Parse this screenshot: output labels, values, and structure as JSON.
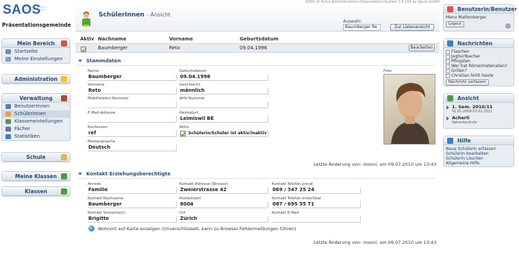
{
  "header": {
    "logo": "SAOS",
    "logo_tagline": "Schul-Administrations-Organisations-System",
    "school": "Präsentationsgemeinde",
    "version_line": "SAOS.ch Schul-Administrations-Organisations-System 0.5.100 by dgure GmbH"
  },
  "left_nav": {
    "mein_bereich": {
      "title": "Mein Bereich",
      "items": [
        "Startseite",
        "Meine Einstellungen"
      ]
    },
    "administration": {
      "title": "Administration"
    },
    "verwaltung": {
      "title": "Verwaltung",
      "items": [
        "BenutzerInnen",
        "SchülerInnen",
        "Klasseneinteilungen",
        "Fächer",
        "Statistiken"
      ]
    },
    "schule": {
      "title": "Schule"
    },
    "meine_klassen": {
      "title": "Meine Klassen"
    },
    "klassen": {
      "title": "Klassen"
    }
  },
  "page": {
    "title": "SchülerInnen",
    "subtitle": "- Ansicht",
    "auswahl_label": "Auswahl:",
    "auswahl_value": "Baumberger Re",
    "listen_button": "Zur Listenansicht"
  },
  "table": {
    "headers": {
      "aktiv": "Aktiv",
      "nachname": "Nachname",
      "vorname": "Vorname",
      "geburtsdatum": "Geburtsdatum"
    },
    "row": {
      "nachname": "Baumberger",
      "vorname": "Reto",
      "geburtsdatum": "09.04.1996"
    },
    "edit_button": "Bearbeiten"
  },
  "stammdaten": {
    "title": "Stammdaten",
    "fields": {
      "name": {
        "label": "Name",
        "value": "Baumberger"
      },
      "geburtsdatum": {
        "label": "Geburtsdatum",
        "value": "09.04.1996"
      },
      "vorname": {
        "label": "Vorname",
        "value": "Reto"
      },
      "geschlecht": {
        "label": "Geschlecht",
        "value": "männlich"
      },
      "mobil": {
        "label": "Mobiltelefon-Nummer",
        "value": ""
      },
      "ahv": {
        "label": "AHV-Nummer",
        "value": ""
      },
      "email": {
        "label": "E-Mail-Adresse",
        "value": ""
      },
      "heimatort": {
        "label": "Heimatort",
        "value": "Leimiswil BE"
      },
      "konfession": {
        "label": "Konfession",
        "value": "ref"
      },
      "aktiv": {
        "label": "Aktiv",
        "value": "Schülerin/Schüler ist aktiv/inaktiv"
      },
      "muttersprache": {
        "label": "Muttersprache",
        "value": "Deutsch"
      }
    },
    "photo_label": "Foto",
    "last_change": "Letzte Änderung von: mooni, am 09.07.2010 um 13:43"
  },
  "kontakt": {
    "title": "Kontakt Erziehungsberechtigte",
    "fields": {
      "anrede": {
        "label": "Anrede",
        "value": "Familie"
      },
      "adresse": {
        "label": "Kontakt Adresse (Strasse)",
        "value": "Zweierstrasse 42"
      },
      "tel_privat": {
        "label": "Kontakt Telefon privat",
        "value": "069 / 347 25 24"
      },
      "nachname": {
        "label": "Kontakt Nachname",
        "value": "Baumberger"
      },
      "plz": {
        "label": "Postleitzahl",
        "value": "8004"
      },
      "tel_erreichbar": {
        "label": "Kontakt Telefon erreichbar",
        "value": "087 / 695 55 71"
      },
      "vorname": {
        "label": "Kontakt Vorname(n)",
        "value": "Brigitte"
      },
      "ort": {
        "label": "Ort",
        "value": "Zürich"
      },
      "email": {
        "label": "Kontakt E-Mail",
        "value": ""
      }
    },
    "map_link": "Wohnort auf Karte anzeigen (Unverschlüsselt, kann zu Browser-Fehlermeldungen führen)",
    "last_change": "Letzte Änderung von: mooni, am 09.07.2010 um 13:43"
  },
  "right": {
    "user": {
      "title": "Benutzerin/Benutzer",
      "name": "Manu Mattenberger",
      "logout": "Logout"
    },
    "nachrichten": {
      "title": "Nachrichten",
      "items": [
        "Flaschen",
        "Joghurtbecher",
        "Pfingsten",
        "Wer hat Römermaterialien?",
        "Grillen?",
        "Christian fehlt heute"
      ],
      "button": "Nachricht verfassen"
    },
    "ansicht": {
      "title": "Ansicht",
      "semester": "1. Sem. 2010/11",
      "semester_range": "01.01.2009-03.02.2011",
      "school": "Acherli",
      "level": "Sekundarstufe"
    },
    "hilfe": {
      "title": "Hilfe",
      "links": [
        "Neue SchülerIn erfassen",
        "SchülerIn bearbeiten",
        "SchülerIn Löschen",
        "Allgemeine Hilfe"
      ]
    }
  }
}
